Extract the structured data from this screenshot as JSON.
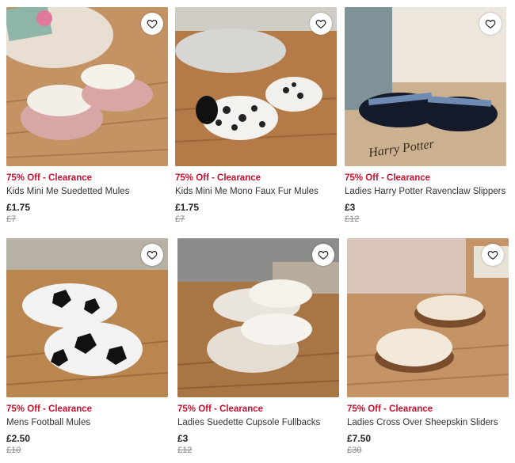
{
  "products": [
    {
      "badge": "75% Off - Clearance",
      "name": "Kids Mini Me Suedetted Mules",
      "price": "£1.75",
      "was": "£7"
    },
    {
      "badge": "75% Off - Clearance",
      "name": "Kids Mini Me Mono Faux Fur Mules",
      "price": "£1.75",
      "was": "£7"
    },
    {
      "badge": "75% Off - Clearance",
      "name": "Ladies Harry Potter Ravenclaw Slippers",
      "price": "£3",
      "was": "£12"
    },
    {
      "badge": "75% Off - Clearance",
      "name": "Mens Football Mules",
      "price": "£2.50",
      "was": "£10"
    },
    {
      "badge": "75% Off - Clearance",
      "name": "Ladies Suedette Cupsole Fullbacks",
      "price": "£3",
      "was": "£12"
    },
    {
      "badge": "75% Off - Clearance",
      "name": "Ladies Cross Over Sheepskin Sliders",
      "price": "£7.50",
      "was": "£30"
    }
  ],
  "brand_print": "Harry Potter",
  "icons": {
    "wishlist": "heart-outline-icon"
  },
  "colors": {
    "badge": "#c8102e",
    "was_price": "#888888"
  }
}
